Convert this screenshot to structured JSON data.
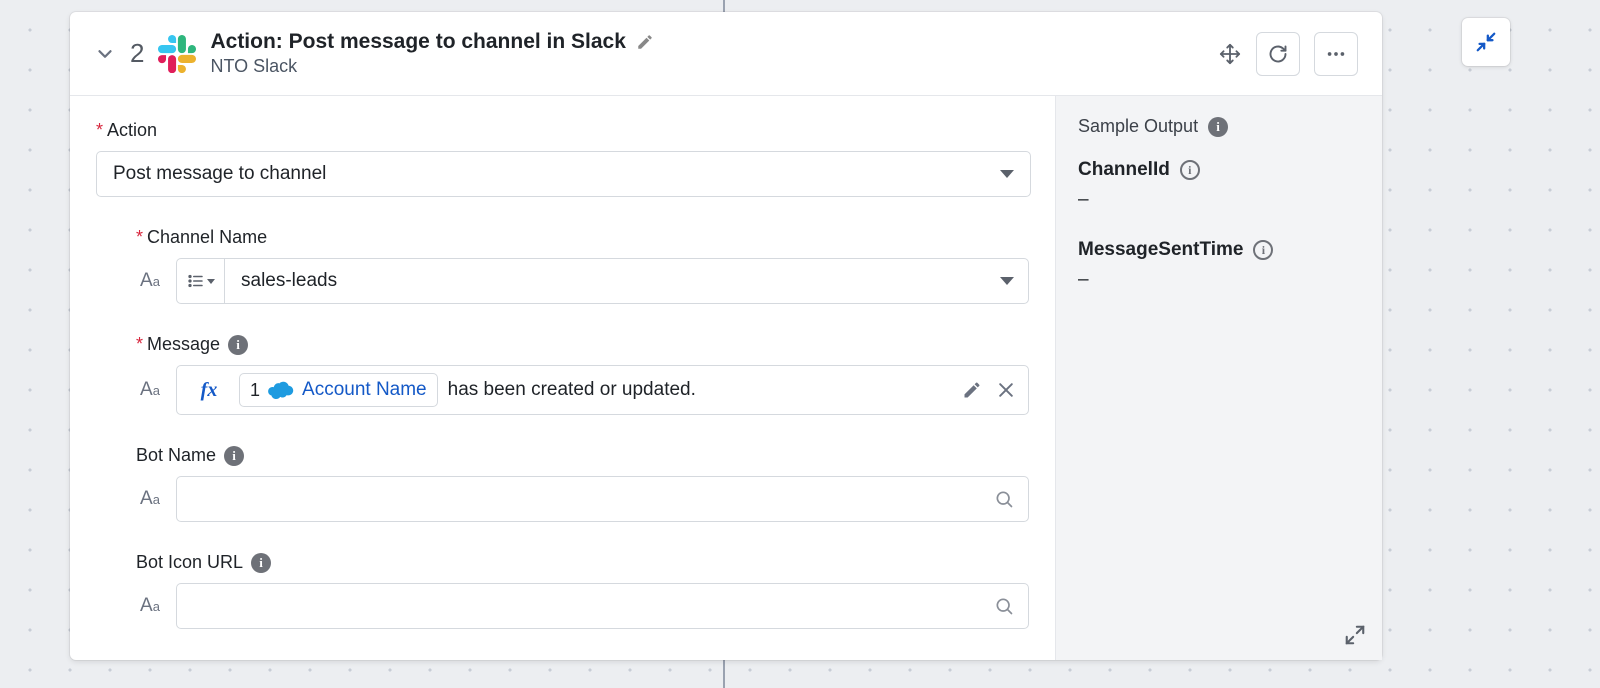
{
  "header": {
    "step_number": "2",
    "title": "Action: Post message to channel in Slack",
    "subtitle": "NTO Slack"
  },
  "form": {
    "action_label": "Action",
    "action_value": "Post message to channel",
    "channel_label": "Channel Name",
    "channel_value": "sales-leads",
    "message_label": "Message",
    "message_pill_step": "1",
    "message_pill_name": "Account Name",
    "message_suffix": " has been created or updated.",
    "botname_label": "Bot Name",
    "boticon_label": "Bot Icon URL"
  },
  "sidebar": {
    "title": "Sample Output",
    "out1_label": "ChannelId",
    "out1_value": "–",
    "out2_label": "MessageSentTime",
    "out2_value": "–"
  }
}
